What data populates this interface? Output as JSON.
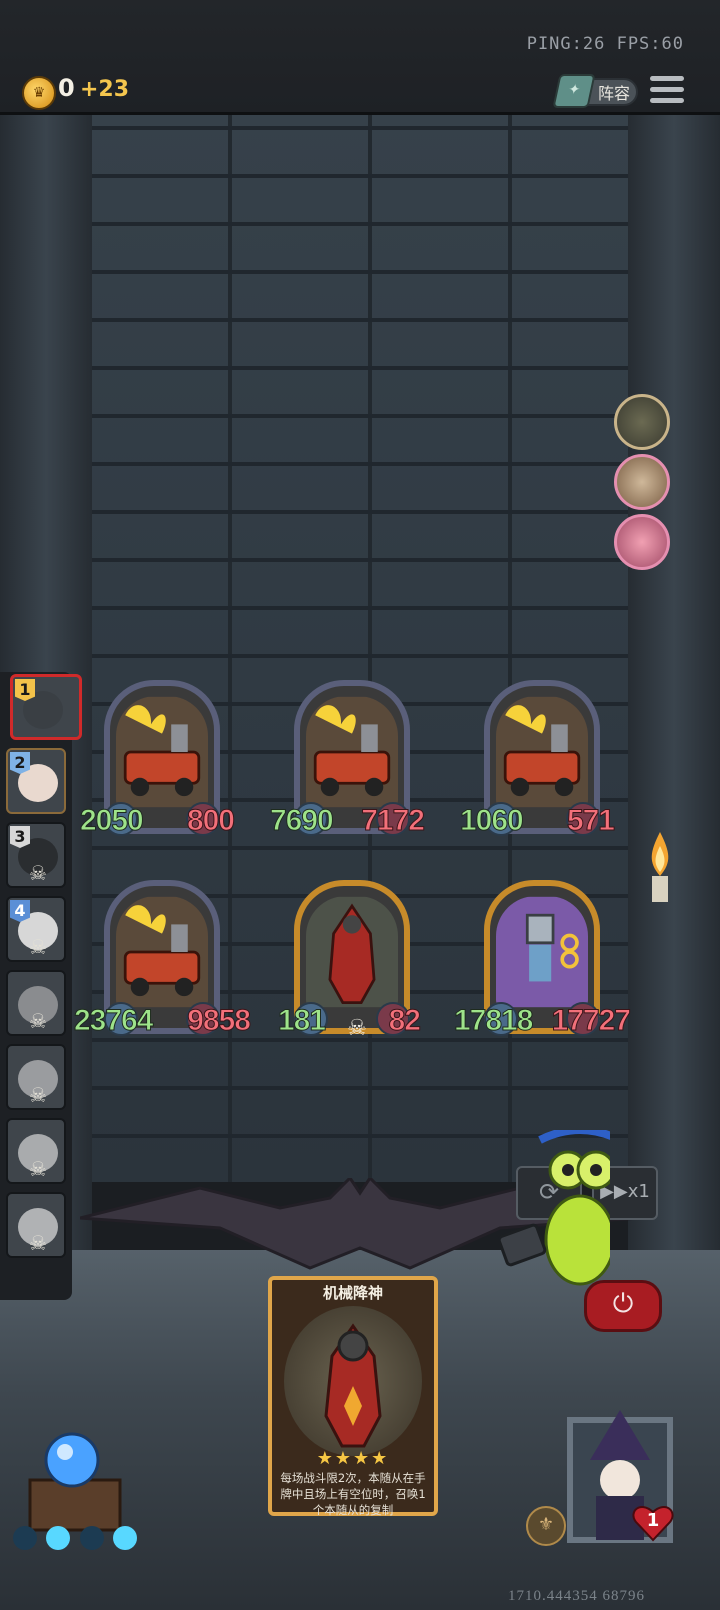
{
  "hud": {
    "status": "PING:26  FPS:60",
    "gold": "0",
    "gold_income": "+23",
    "lineup_label": "阵容"
  },
  "opponents": [
    {
      "rank": "1",
      "state": "active"
    },
    {
      "rank": "2",
      "state": "alive"
    },
    {
      "rank": "3",
      "state": "dead"
    },
    {
      "rank": "4",
      "state": "dead"
    },
    {
      "rank": "",
      "state": "dead"
    },
    {
      "rank": "",
      "state": "dead"
    },
    {
      "rank": "",
      "state": "dead"
    },
    {
      "rank": "",
      "state": "dead"
    }
  ],
  "board": [
    {
      "attack": "2050",
      "health": "800",
      "frame": "normal",
      "art": "fire-car"
    },
    {
      "attack": "7690",
      "health": "7172",
      "frame": "normal",
      "art": "fire-car"
    },
    {
      "attack": "1060",
      "health": "571",
      "frame": "normal",
      "art": "fire-car"
    },
    {
      "attack": "23764",
      "health": "9858",
      "frame": "normal",
      "art": "fire-car"
    },
    {
      "attack": "181",
      "health": "82",
      "frame": "gold",
      "art": "mech-god",
      "deathrattle": "☠"
    },
    {
      "attack": "17818",
      "health": "17727",
      "frame": "gold",
      "art": "robot-painter"
    }
  ],
  "hand_card": {
    "title": "机械降神",
    "stars": "★★★★",
    "description": "每场战斗限2次，本随从在手牌中且场上有空位时，召唤1个本随从的复制"
  },
  "controls": {
    "reset_icon": "⟳",
    "speed_label": "▶▶x1",
    "power_icon": "⏻"
  },
  "hero": {
    "health": "1",
    "power_icon": "⚜"
  },
  "footer": {
    "build_number": "1710.444354 68796"
  },
  "colors": {
    "attack": "#9ee38a",
    "health": "#f2707a",
    "gold_frame": "#c78b2a",
    "normal_frame": "#5a5f7a"
  }
}
